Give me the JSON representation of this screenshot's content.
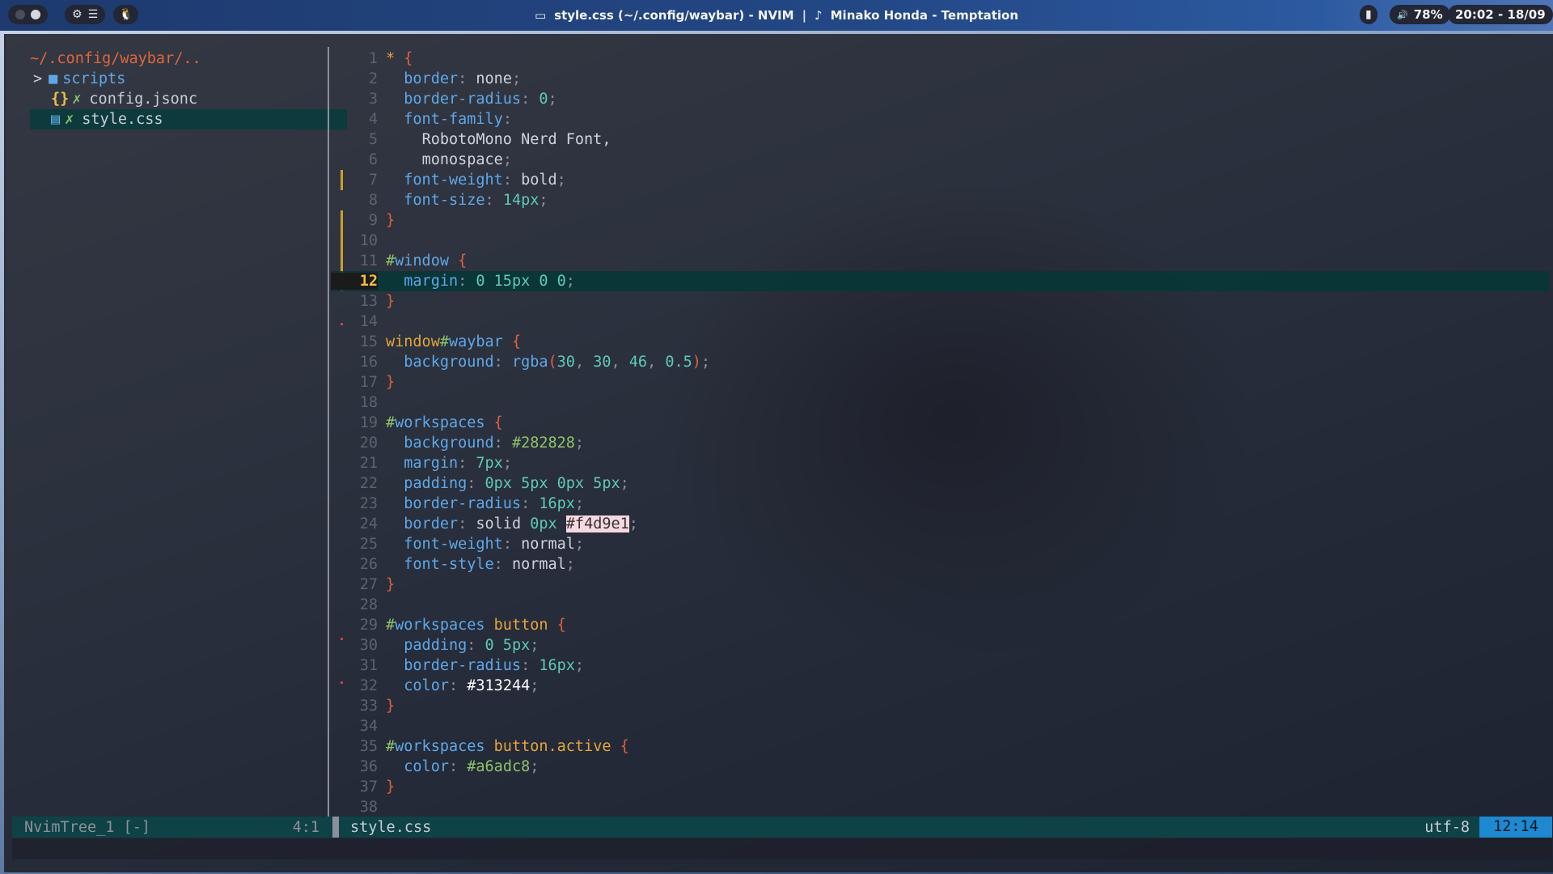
{
  "waybar": {
    "title_icon": "terminal-window-icon",
    "window_title": "style.css (~/.config/waybar) - NVIM",
    "separator": "|",
    "music_note": "♪",
    "music": "Minako Honda - Temptation",
    "volume_icon": "🔊",
    "volume": "78%",
    "clock": "20:02 - 18/09"
  },
  "tree": {
    "root": "~/.config/waybar/..",
    "items": [
      {
        "chevron": ">",
        "name": "scripts",
        "git": ""
      },
      {
        "chevron": "",
        "name": "config.jsonc",
        "git": "✗"
      },
      {
        "chevron": "",
        "name": "style.css",
        "git": "✗"
      }
    ]
  },
  "editor": {
    "current_line": 12,
    "lines": [
      {
        "n": "1"
      },
      {
        "n": "2"
      },
      {
        "n": "3"
      },
      {
        "n": "4"
      },
      {
        "n": "5"
      },
      {
        "n": "6"
      },
      {
        "n": "7"
      },
      {
        "n": "8"
      },
      {
        "n": "9"
      },
      {
        "n": "10"
      },
      {
        "n": "11"
      },
      {
        "n": "12"
      },
      {
        "n": "13"
      },
      {
        "n": "14"
      },
      {
        "n": "15"
      },
      {
        "n": "16"
      },
      {
        "n": "17"
      },
      {
        "n": "18"
      },
      {
        "n": "19"
      },
      {
        "n": "20"
      },
      {
        "n": "21"
      },
      {
        "n": "22"
      },
      {
        "n": "23"
      },
      {
        "n": "24"
      },
      {
        "n": "25"
      },
      {
        "n": "26"
      },
      {
        "n": "27"
      },
      {
        "n": "28"
      },
      {
        "n": "29"
      },
      {
        "n": "30"
      },
      {
        "n": "31"
      },
      {
        "n": "32"
      },
      {
        "n": "33"
      },
      {
        "n": "34"
      },
      {
        "n": "35"
      },
      {
        "n": "36"
      },
      {
        "n": "37"
      },
      {
        "n": "38"
      }
    ],
    "code": {
      "l1_sel": "*",
      "brace_open": "{",
      "brace_close": "}",
      "p_border": "border",
      "v_none": "none",
      "p_border_radius": "border-radius",
      "v_0": "0",
      "p_font_family": "font-family",
      "v_roboto": "RobotoMono Nerd Font,",
      "v_monospace": "monospace",
      "p_font_weight": "font-weight",
      "v_bold": "bold",
      "p_font_size": "font-size",
      "v_14px": "14px",
      "hash": "#",
      "n_window": "window",
      "p_margin": "margin",
      "v_margin12": "0 15px 0 0",
      "t_window": "window",
      "n_waybar": "waybar",
      "p_background": "background",
      "v_rgba_fn": "rgba",
      "v_rgba_args": [
        "30",
        "30",
        "46",
        "0.5"
      ],
      "n_workspaces": "workspaces",
      "v_282828": "#282828",
      "v_7px": "7px",
      "p_padding": "padding",
      "v_pad22": "0px 5px 0px 5px",
      "v_16px": "16px",
      "v_solid": "solid",
      "v_0px": "0px",
      "v_f4d9e1": "#f4d9e1",
      "v_normal": "normal",
      "p_font_style": "font-style",
      "t_button": "button",
      "v_pad30": "0 5px",
      "p_color": "color",
      "v_313244": "#313244",
      "c_active": ".active",
      "v_a6adc8": "#a6adc8"
    }
  },
  "status": {
    "tree_name": "NvimTree_1 [-]",
    "tree_pos": "4:1",
    "file": "style.css",
    "encoding": "utf-8",
    "position": "12:14"
  },
  "colors": {
    "accent": "#1e88d0",
    "statusline": "#0e4246",
    "tree_root": "#e0653b"
  }
}
